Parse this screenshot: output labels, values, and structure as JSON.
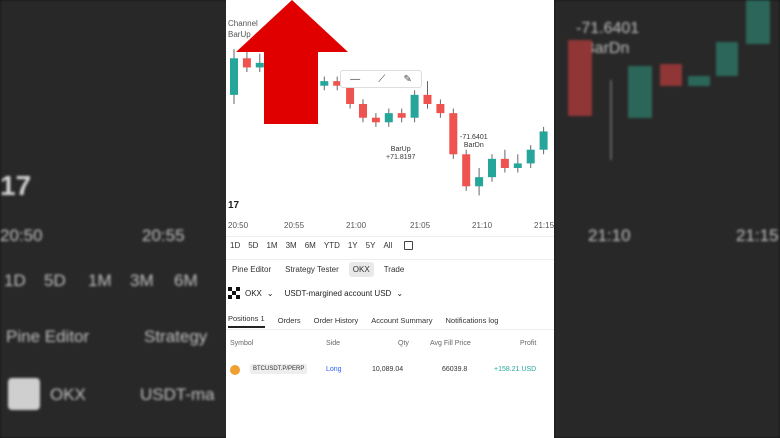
{
  "left_side": {
    "logo": "17",
    "axis_times": [
      "20:50",
      "20:55"
    ],
    "ranges": [
      "1D",
      "5D",
      "1M",
      "3M",
      "6M"
    ],
    "tabs": [
      "Pine Editor",
      "Strategy"
    ],
    "broker": "OKX",
    "account": "USDT-ma"
  },
  "right_side": {
    "annotation_value": "-71.6401",
    "annotation_label": "BarDn",
    "axis_times": [
      "21:10",
      "21:15"
    ]
  },
  "chart": {
    "legend": [
      "Channel",
      "BarUp"
    ],
    "drawing_tools": [
      "line-tool",
      "ray-tool",
      "brush-tool"
    ],
    "annotation_dn": {
      "value": "-71.6401",
      "label": "BarDn"
    },
    "annotation_up": {
      "label": "BarUp",
      "value": "+71.8197"
    },
    "axis_times": [
      "20:50",
      "20:55",
      "21:00",
      "21:05",
      "21:10",
      "21:15"
    ],
    "candles": [
      {
        "o": 6,
        "c": 14,
        "h": 16,
        "l": 4
      },
      {
        "o": 14,
        "c": 12,
        "h": 16,
        "l": 11
      },
      {
        "o": 12,
        "c": 13,
        "h": 15,
        "l": 11
      },
      {
        "o": 13,
        "c": 15,
        "h": 17,
        "l": 12
      },
      {
        "o": 15,
        "c": 14,
        "h": 16,
        "l": 13
      },
      {
        "o": 14,
        "c": 13,
        "h": 15,
        "l": 12
      },
      {
        "o": 13,
        "c": 8,
        "h": 14,
        "l": 7
      },
      {
        "o": 8,
        "c": 9,
        "h": 10,
        "l": 7
      },
      {
        "o": 9,
        "c": 8,
        "h": 10,
        "l": 7
      },
      {
        "o": 8,
        "c": 4,
        "h": 9,
        "l": 3
      },
      {
        "o": 4,
        "c": 1,
        "h": 5,
        "l": 0
      },
      {
        "o": 1,
        "c": 0,
        "h": 2,
        "l": -1
      },
      {
        "o": 0,
        "c": 2,
        "h": 3,
        "l": -1
      },
      {
        "o": 2,
        "c": 1,
        "h": 3,
        "l": 0
      },
      {
        "o": 1,
        "c": 6,
        "h": 7,
        "l": 0
      },
      {
        "o": 6,
        "c": 4,
        "h": 9,
        "l": 3
      },
      {
        "o": 4,
        "c": 2,
        "h": 5,
        "l": 1
      },
      {
        "o": 2,
        "c": -7,
        "h": 3,
        "l": -8
      },
      {
        "o": -7,
        "c": -14,
        "h": -6,
        "l": -15
      },
      {
        "o": -14,
        "c": -12,
        "h": -10,
        "l": -16
      },
      {
        "o": -12,
        "c": -8,
        "h": -7,
        "l": -13
      },
      {
        "o": -8,
        "c": -10,
        "h": -6,
        "l": -11
      },
      {
        "o": -10,
        "c": -9,
        "h": -7,
        "l": -11
      },
      {
        "o": -9,
        "c": -6,
        "h": -5,
        "l": -10
      },
      {
        "o": -6,
        "c": -2,
        "h": -1,
        "l": -7
      }
    ]
  },
  "ranges": [
    "1D",
    "5D",
    "1M",
    "3M",
    "6M",
    "YTD",
    "1Y",
    "5Y",
    "All"
  ],
  "tabs": [
    "Pine Editor",
    "Strategy Tester",
    "OKX",
    "Trade"
  ],
  "broker": {
    "name": "OKX",
    "account": "USDT-margined account USD"
  },
  "subtabs": [
    "Positions 1",
    "Orders",
    "Order History",
    "Account Summary",
    "Notifications log"
  ],
  "positions": {
    "headers": [
      "Symbol",
      "Side",
      "Qty",
      "Avg Fill Price",
      "Profit"
    ],
    "rows": [
      {
        "symbol": "BTCUSDT.P/PERP",
        "side": "Long",
        "qty": "10,089.04",
        "avg": "66039.8",
        "profit": "+158.21 USD"
      }
    ]
  },
  "colors": {
    "up": "#26a69a",
    "down": "#ef5350",
    "arrow": "#e00000"
  }
}
